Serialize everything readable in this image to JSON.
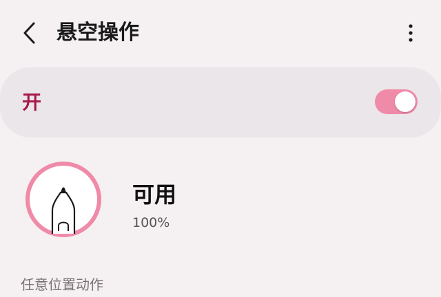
{
  "header": {
    "title": "悬空操作",
    "back_icon": "chevron-left-icon",
    "more_icon": "more-vertical-icon"
  },
  "master_switch": {
    "label": "开",
    "state": "on",
    "accent_color": "#f08aa9",
    "label_color": "#a8174a"
  },
  "pen_status": {
    "icon": "s-pen-battery-ring-icon",
    "status_label": "可用",
    "battery_text": "100%",
    "battery_level": 1.0,
    "ring_color": "#f08aa9"
  },
  "section": {
    "title": "任意位置动作"
  }
}
